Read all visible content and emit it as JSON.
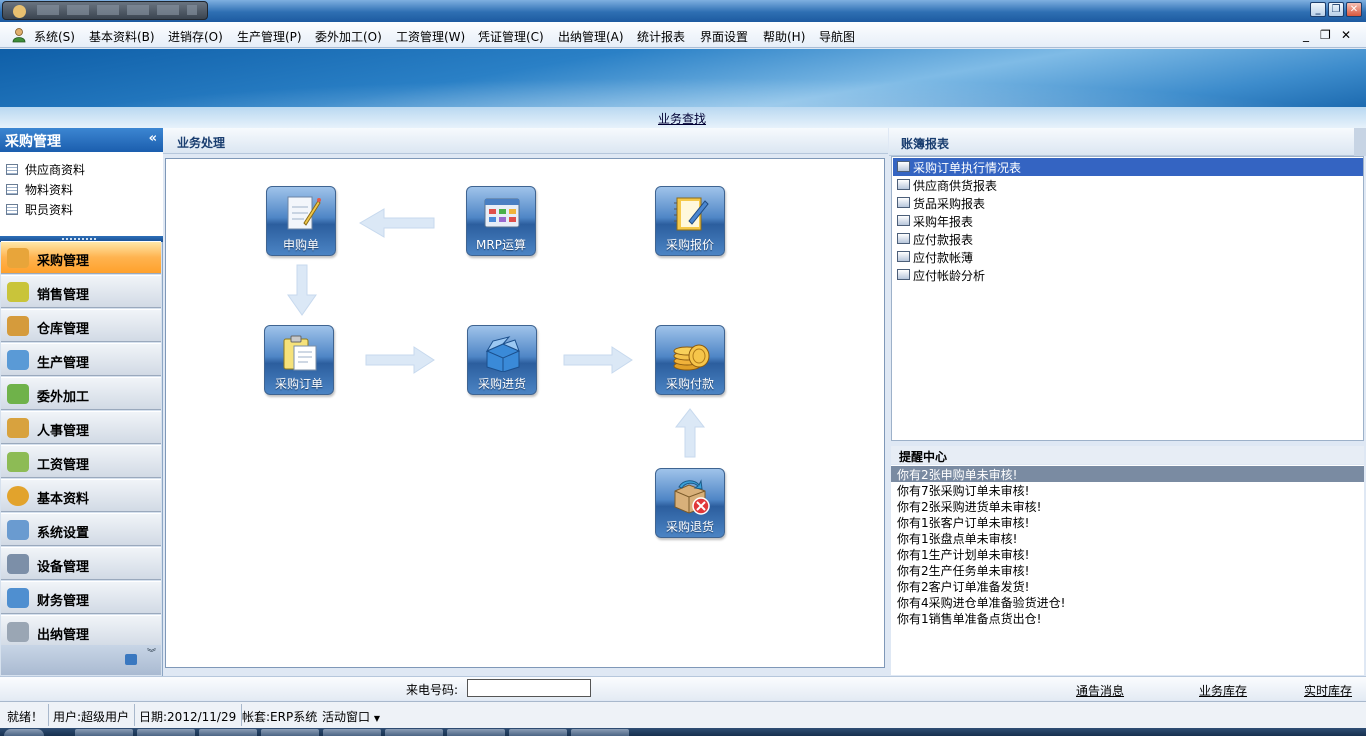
{
  "menu": {
    "items": [
      "系统(S)",
      "基本资料(B)",
      "进销存(O)",
      "生产管理(P)",
      "委外加工(O)",
      "工资管理(W)",
      "凭证管理(C)",
      "出纳管理(A)",
      "统计报表",
      "界面设置",
      "帮助(H)",
      "导航图"
    ],
    "mdi_min": "_",
    "mdi_restore": "❐",
    "mdi_close": "✕"
  },
  "window": {
    "min": "_",
    "restore": "❐",
    "close": "✕"
  },
  "banner": {
    "link": "业务查找"
  },
  "sidebar": {
    "title": "采购管理",
    "collapse": "«",
    "sub_items": [
      "供应商资料",
      "物料资料",
      "职员资料"
    ],
    "modules": [
      {
        "label": "采购管理",
        "active": true,
        "icon": "cart-icon",
        "color": "#e8a53a"
      },
      {
        "label": "销售管理",
        "active": false,
        "icon": "sales-icon",
        "color": "#c9c43a"
      },
      {
        "label": "仓库管理",
        "active": false,
        "icon": "warehouse-icon",
        "color": "#d59b3c"
      },
      {
        "label": "生产管理",
        "active": false,
        "icon": "production-icon",
        "color": "#5a9ad6"
      },
      {
        "label": "委外加工",
        "active": false,
        "icon": "outsource-icon",
        "color": "#6fb24a"
      },
      {
        "label": "人事管理",
        "active": false,
        "icon": "people-icon",
        "color": "#d8a23e"
      },
      {
        "label": "工资管理",
        "active": false,
        "icon": "salary-icon",
        "color": "#8dbb55"
      },
      {
        "label": "基本资料",
        "active": false,
        "icon": "gear-icon",
        "color": "#e2a32c"
      },
      {
        "label": "系统设置",
        "active": false,
        "icon": "settings-icon",
        "color": "#6a9bd0"
      },
      {
        "label": "设备管理",
        "active": false,
        "icon": "equipment-icon",
        "color": "#7c8fa8"
      },
      {
        "label": "财务管理",
        "active": false,
        "icon": "finance-icon",
        "color": "#4f8fd0"
      },
      {
        "label": "出纳管理",
        "active": false,
        "icon": "cashier-icon",
        "color": "#9aa6b4"
      }
    ],
    "footer_chevron": "︾"
  },
  "workflow": {
    "title": "业务处理",
    "nodes": {
      "purchase_request": {
        "label": "申购单",
        "icon": "request-form-icon",
        "color": "#f3f6fb"
      },
      "mrp": {
        "label": "MRP运算",
        "icon": "mrp-calc-icon",
        "color": "#e8eef7"
      },
      "quote": {
        "label": "采购报价",
        "icon": "notebook-pen-icon",
        "color": "#f5c94b"
      },
      "order": {
        "label": "采购订单",
        "icon": "clipboard-icon",
        "color": "#f6e27a"
      },
      "receipt": {
        "label": "采购进货",
        "icon": "box-icon",
        "color": "#3a8ad8"
      },
      "payment": {
        "label": "采购付款",
        "icon": "coins-icon",
        "color": "#f0b23a"
      },
      "return": {
        "label": "采购退货",
        "icon": "return-box-icon",
        "color": "#d8b07a"
      }
    }
  },
  "reports": {
    "title": "账簿报表",
    "items": [
      "采购订单执行情况表",
      "供应商供货报表",
      "货品采购报表",
      "采购年报表",
      "应付款报表",
      "应付款帐薄",
      "应付帐龄分析"
    ],
    "selected_index": 0
  },
  "reminders": {
    "title": "提醒中心",
    "items": [
      "你有2张申购单未审核!",
      "你有7张采购订单未审核!",
      "你有2张采购进货单未审核!",
      "你有1张客户订单未审核!",
      "你有1张盘点单未审核!",
      "你有1生产计划单未审核!",
      "你有2生产任务单未审核!",
      "你有2客户订单准备发货!",
      "你有4采购进仓单准备验货进仓!",
      "你有1销售单准备点货出仓!"
    ],
    "selected_index": 0
  },
  "phonebar": {
    "label": "来电号码:",
    "value": "",
    "links": [
      "通告消息",
      "业务库存",
      "实时库存"
    ]
  },
  "status": {
    "ready": "就绪！",
    "user": "用户:超级用户",
    "date": "日期:2012/11/29",
    "account": "帐套:ERP系统",
    "active_window": "活动窗口"
  },
  "colors": {
    "accent": "#2a6fc0",
    "active_module": "#ffa12c",
    "selected_report": "#3464c2"
  }
}
